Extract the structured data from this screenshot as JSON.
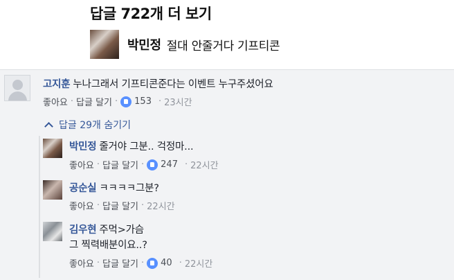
{
  "header": {
    "title": "답글 722개 더 보기",
    "author": "박민정",
    "text": "절대 안줄거다 기프티콘"
  },
  "colors": {
    "link": "#365899",
    "like": "#5890ff",
    "meta": "#90949c"
  },
  "comment": {
    "author": "고지훈",
    "text": "누나그래서 기프티콘준다는 이벤트 누구주셨어요",
    "like": "좋아요",
    "reply": "답글 달기",
    "likes": "153",
    "time": "23시간"
  },
  "toggle": {
    "label": "답글 29개 숨기기",
    "icon": "chevron-up-icon"
  },
  "replies": [
    {
      "author": "박민정",
      "line1": "줄거야 그분.. 걱정마...",
      "like": "좋아요",
      "reply": "답글 달기",
      "likes": "247",
      "time": "22시간"
    },
    {
      "author": "공순실",
      "line1": "ㅋㅋㅋㅋ그분?",
      "like": "좋아요",
      "reply": "답글 달기",
      "time": "22시간"
    },
    {
      "author": "김우현",
      "line1": "주먹>가슴",
      "line2": "그 찍력배분이요..?",
      "like": "좋아요",
      "reply": "답글 달기",
      "likes": "40",
      "time": "22시간"
    }
  ]
}
